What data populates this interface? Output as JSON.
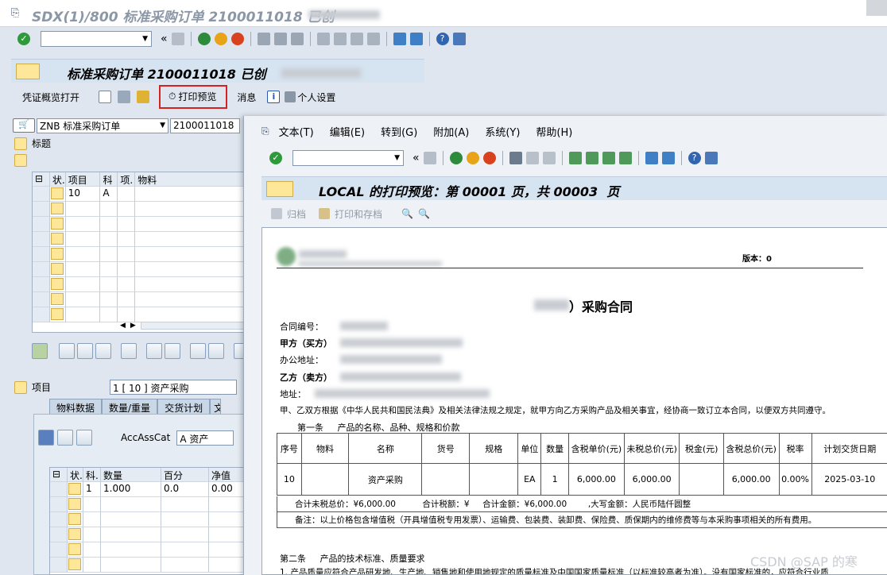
{
  "window": {
    "title": "SDX(1)/800 标准采购订单 2100011018 已创"
  },
  "screen": {
    "title": "标准采购订单 2100011018 已创"
  },
  "app_toolbar": {
    "items": [
      "凭证概览打开",
      "打印预览",
      "消息",
      "个人设置"
    ]
  },
  "doc_type": {
    "value": "ZNB 标准采购订单",
    "po_number": "2100011018"
  },
  "header_label": "标题",
  "items_table": {
    "headers": [
      "状.",
      "项目",
      "科",
      "项.",
      "物料"
    ],
    "rows": [
      {
        "item": "10",
        "acct": "A"
      }
    ]
  },
  "item_section": {
    "label": "项目",
    "value": "1 [ 10 ] 资产采购"
  },
  "item_tabs": [
    "物料数据",
    "数量/重量",
    "交货计划",
    "文"
  ],
  "acc_ass_cat": {
    "label": "AccAssCat",
    "value": "A 资产"
  },
  "acct_table": {
    "headers": [
      "状.",
      "科.",
      "数量",
      "百分",
      "净值"
    ],
    "rows": [
      {
        "k": "1",
        "qty": "1.000",
        "pct": "0.0",
        "net": "0.00"
      }
    ]
  },
  "preview_window": {
    "menu": [
      "文本(T)",
      "编辑(E)",
      "转到(G)",
      "附加(A)",
      "系统(Y)",
      "帮助(H)"
    ],
    "title": "LOCAL 的打印预览：第 00001 页，共 00003  页",
    "buttons": [
      "归档",
      "打印和存档"
    ]
  },
  "document": {
    "version": "版本：0",
    "heading": "）采购合同",
    "fields": [
      "合同编号：",
      "甲方（买方）",
      "办公地址：",
      "乙方（卖方）",
      "地址："
    ],
    "intro": "甲、乙双方根据《中华人民共和国民法典》及相关法律法规之规定，就甲方向乙方采购产品及相关事宜，经协商一致订立本合同，以便双方共同遵守。",
    "article1": "第一条     产品的名称、品种、规格和价款",
    "table_headers": [
      "序号",
      "物料",
      "名称",
      "货号",
      "规格",
      "单位",
      "数量",
      "含税单价(元)",
      "未税总价(元)",
      "税金(元)",
      "含税总价(元)",
      "税率",
      "计划交货日期"
    ],
    "table_row": [
      "10",
      "",
      "资产采购",
      "",
      "",
      "EA",
      "1",
      "6,000.00",
      "6,000.00",
      "",
      "6,000.00",
      "0.00%",
      "2025-03-10"
    ],
    "totals": "合计未税总价：¥6,000.00          合计税额：¥     合计金额：¥6,000.00        ,大写金额：人民币陆仟圆整",
    "remark": "备注：以上价格包含增值税（开具增值税专用发票）、运输费、包装费、装卸费、保险费、质保期内的维修费等与本采购事项相关的所有费用。",
    "article2": "第二条     产品的技术标准、质量要求",
    "clause1": "1. 产品质量应符合产品研发地、生产地、销售地和使用地规定的质量标准及中国国家质量标准（以标准较高者为准）。没有国家标准的，应符合行业质"
  },
  "watermark": "CSDN @SAP 的寒"
}
